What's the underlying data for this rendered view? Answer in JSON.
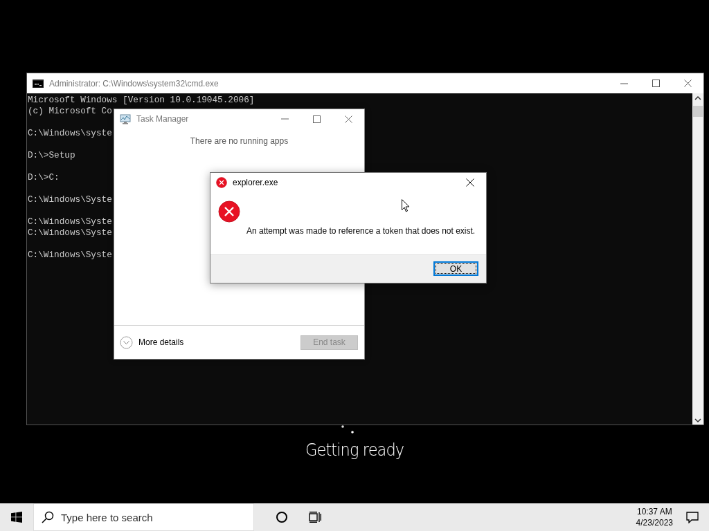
{
  "console_window": {
    "title": "Administrator: C:\\Windows\\system32\\cmd.exe",
    "blocks": [
      [
        "Microsoft Windows [Version 10.0.19045.2006]",
        "(c) Microsoft Co"
      ],
      [
        "C:\\Windows\\syste"
      ],
      [
        "D:\\>Setup"
      ],
      [
        "D:\\>C:"
      ],
      [
        "C:\\Windows\\Syste"
      ],
      [
        "C:\\Windows\\Syste",
        "C:\\Windows\\Syste"
      ],
      [
        "C:\\Windows\\Syste"
      ]
    ]
  },
  "task_manager": {
    "title": "Task Manager",
    "message": "There are no running apps",
    "more_details": "More details",
    "end_task": {
      "label": "End task",
      "disabled": true
    }
  },
  "error_dialog": {
    "title": "explorer.exe",
    "message": "An attempt was made to reference a token that does not exist.",
    "ok_button": {
      "label": "OK",
      "focused": true
    }
  },
  "setup_status": "Getting ready",
  "taskbar": {
    "search": {
      "placeholder": "Type here to search"
    },
    "time": "10:37 AM",
    "date": "4/23/2023"
  }
}
